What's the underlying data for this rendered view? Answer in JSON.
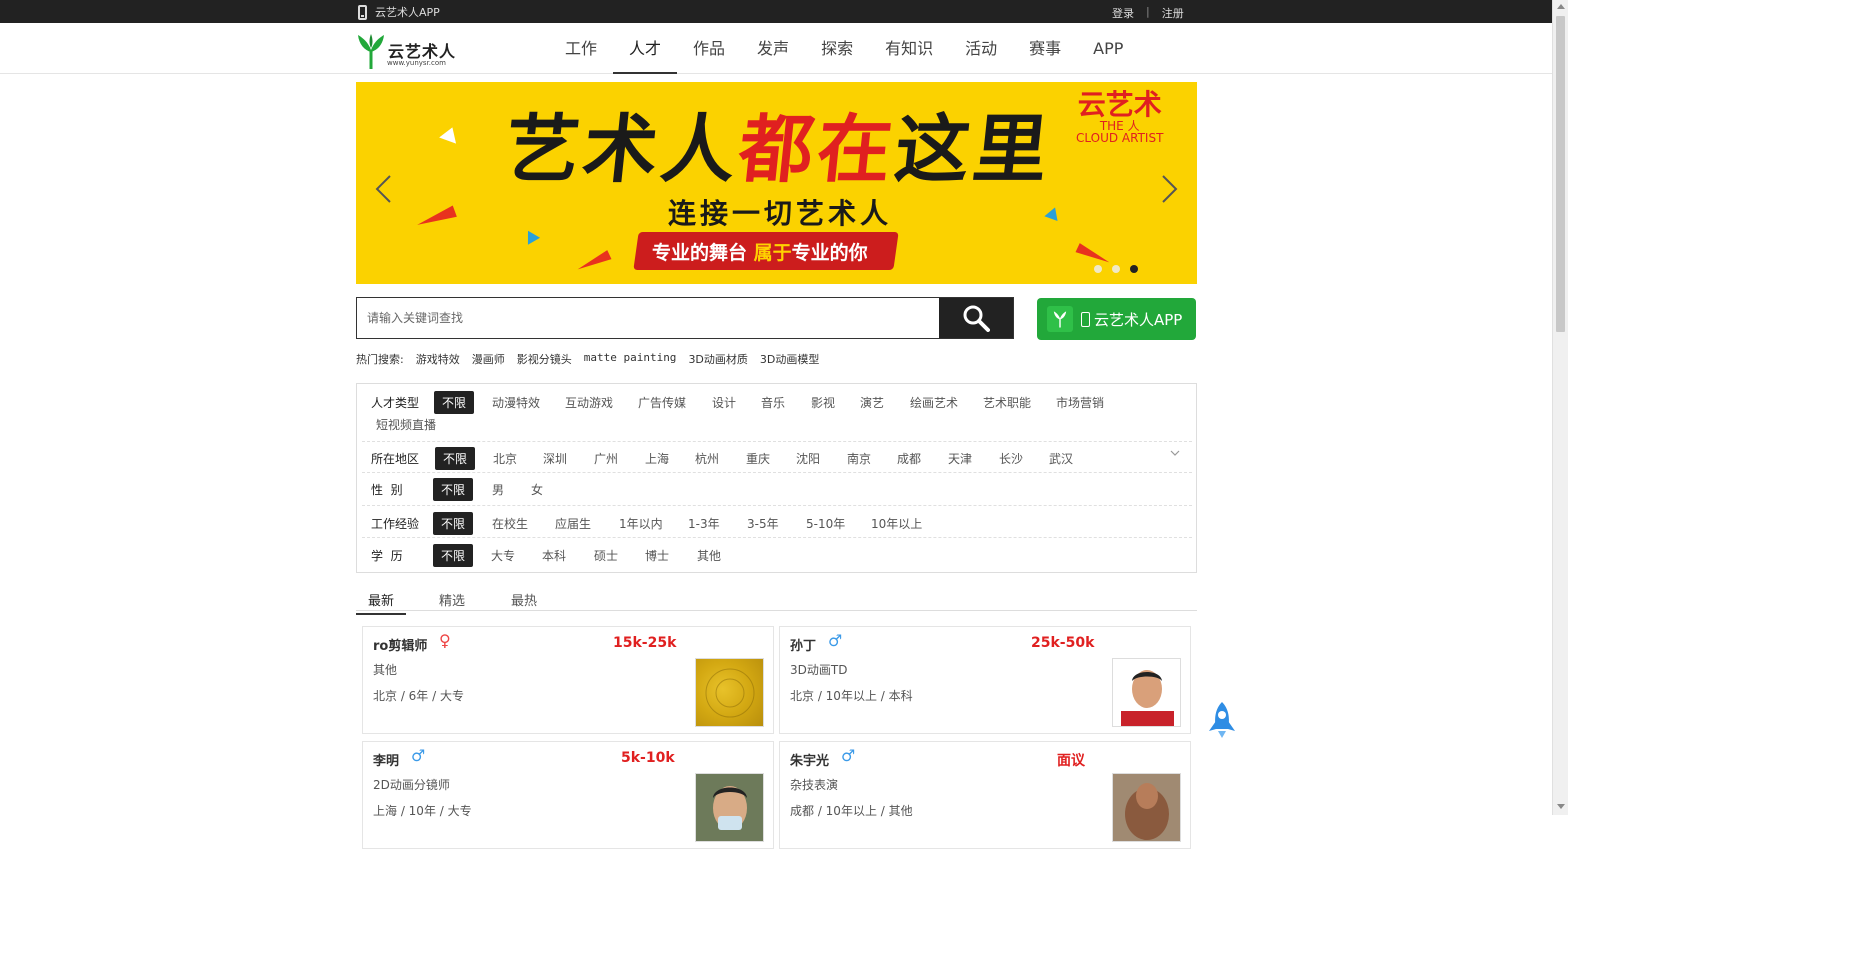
{
  "topbar": {
    "app_link": "云艺术人APP",
    "login": "登录",
    "separator": "|",
    "register": "注册"
  },
  "logo": {
    "name": "云艺术人",
    "url": "www.yunysr.com"
  },
  "nav": [
    {
      "label": "工作",
      "active": false
    },
    {
      "label": "人才",
      "active": true
    },
    {
      "label": "作品",
      "active": false
    },
    {
      "label": "发声",
      "active": false
    },
    {
      "label": "探索",
      "active": false
    },
    {
      "label": "有知识",
      "active": false
    },
    {
      "label": "活动",
      "active": false
    },
    {
      "label": "赛事",
      "active": false
    },
    {
      "label": "APP",
      "active": false
    }
  ],
  "banner": {
    "headline_a": "艺术人",
    "headline_b": "都在",
    "headline_c": "这里",
    "sub": "连接一切艺术人",
    "tagline_a": "专业的舞台 ",
    "tagline_b": "属于",
    "tagline_c": "专业的你",
    "brand_cn": "云艺术",
    "brand_en1": "THE 人",
    "brand_en2": "CLOUD ARTIST",
    "slides": 3,
    "active_slide": 3,
    "bg_color": "#fbd200"
  },
  "search": {
    "placeholder": "请输入关键词查找",
    "app_button": "云艺术人APP"
  },
  "hot": {
    "label": "热门搜索:",
    "items": [
      "游戏特效",
      "漫画师",
      "影视分镜头",
      "matte painting",
      "3D动画材质",
      "3D动画模型"
    ]
  },
  "filters": {
    "type": {
      "label": "人才类型",
      "options": [
        "不限",
        "动漫特效",
        "互动游戏",
        "广告传媒",
        "设计",
        "音乐",
        "影视",
        "演艺",
        "绘画艺术",
        "艺术职能",
        "市场营销",
        "短视频直播"
      ]
    },
    "region": {
      "label": "所在地区",
      "options": [
        "不限",
        "北京",
        "深圳",
        "广州",
        "上海",
        "杭州",
        "重庆",
        "沈阳",
        "南京",
        "成都",
        "天津",
        "长沙",
        "武汉"
      ]
    },
    "gender": {
      "label": "性  别",
      "options": [
        "不限",
        "男",
        "女"
      ]
    },
    "experience": {
      "label": "工作经验",
      "options": [
        "不限",
        "在校生",
        "应届生",
        "1年以内",
        "1-3年",
        "3-5年",
        "5-10年",
        "10年以上"
      ]
    },
    "education": {
      "label": "学  历",
      "options": [
        "不限",
        "大专",
        "本科",
        "硕士",
        "博士",
        "其他"
      ]
    }
  },
  "tabs": [
    "最新",
    "精选",
    "最热"
  ],
  "cards": [
    {
      "name": "ro剪辑师",
      "gender": "female",
      "gender_symbol": "♀",
      "salary": "15k-25k",
      "role": "其他",
      "meta": "北京 / 6年 / 大专"
    },
    {
      "name": "孙丁",
      "gender": "male",
      "gender_symbol": "♂",
      "salary": "25k-50k",
      "role": "3D动画TD",
      "meta": "北京 / 10年以上 / 本科"
    },
    {
      "name": "李明",
      "gender": "male",
      "gender_symbol": "♂",
      "salary": "5k-10k",
      "role": "2D动画分镜师",
      "meta": "上海 / 10年 / 大专"
    },
    {
      "name": "朱宇光",
      "gender": "male",
      "gender_symbol": "♂",
      "salary": "面议",
      "role": "杂技表演",
      "meta": "成都 / 10年以上 / 其他"
    }
  ],
  "colors": {
    "accent_green": "#22a83a",
    "salary_red": "#e02020",
    "male_blue": "#3b9ae8",
    "dark": "#222222"
  }
}
